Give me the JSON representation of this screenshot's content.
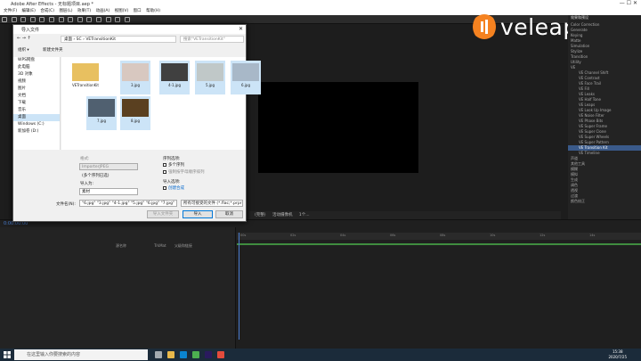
{
  "window": {
    "title": "Adobe After Effects - 无标题项目.aep *"
  },
  "menu": [
    "文件(F)",
    "编辑(E)",
    "合成(C)",
    "图层(L)",
    "效果(T)",
    "动画(A)",
    "视图(V)",
    "窗口",
    "帮助(H)"
  ],
  "brand": {
    "logo_text": "veleap.com",
    "accent": "#f58220"
  },
  "dialog": {
    "title": "导入文件",
    "breadcrumb": [
      "桌面",
      "SC",
      "VETransitionKit"
    ],
    "search_placeholder": "搜索\"VETransitionKit\"",
    "toolbar": {
      "organize": "组织 ▾",
      "new_folder": "新建文件夹"
    },
    "nav": [
      "WPS网盘",
      "此电脑",
      "3D 对象",
      "视频",
      "图片",
      "文档",
      "下载",
      "音乐",
      "桌面",
      "Windows (C:)",
      "新加卷 (D:)"
    ],
    "nav_selected": "桌面",
    "files": [
      {
        "name": "VETransitionKit",
        "type": "folder"
      },
      {
        "name": "3.jpg",
        "type": "image"
      },
      {
        "name": "4-1.jpg",
        "type": "image"
      },
      {
        "name": "5.jpg",
        "type": "image"
      },
      {
        "name": "6.jpg",
        "type": "image"
      },
      {
        "name": "7.jpg",
        "type": "image"
      },
      {
        "name": "8.jpg",
        "type": "image"
      }
    ],
    "format_label": "格式:",
    "format_value": "ImporterJPEG",
    "multi_label": "(多个序列已选)",
    "import_as_label": "导入为:",
    "import_as_value": "素材",
    "sequence_options_label": "序列选项:",
    "sequence_checkbox": "多个序列",
    "force_alpha": "强制按字母顺序排列",
    "import_options_label": "导入选项:",
    "create_comp": "创建合成",
    "filename_label": "文件名(N):",
    "filename_value": "\"6.jpg\" \"3.jpg\" \"4-1.jpg\" \"5.jpg\" \"6.jpg\" \"7.jpg\"",
    "filetype_value": "所有可接受的文件 (*.flac;*.prpr",
    "btn_import_folder": "导入文件夹",
    "btn_import": "导入",
    "btn_cancel": "取消"
  },
  "viewer": {
    "zoom": "(完整)",
    "camera": "活动摄像机",
    "views": "1个..."
  },
  "effects_panel": {
    "search_label": "效果和预设",
    "items": [
      "Color Correction",
      "Generate",
      "Keying",
      "Matte",
      "Simulation",
      "Stylize",
      "Transition",
      "Utility",
      "VE",
      "VE Channel Shift",
      "VE Contrast",
      "VE Face Trail",
      "VE Fill",
      "VE Leaks",
      "VE Half Tone",
      "VE Leaps",
      "VE Look Up Image",
      "VE Noise Filter",
      "VE Phase Bits",
      "VE Super Frame",
      "VE Super Clone",
      "VE Super Wheels",
      "VE Super Pattern",
      "VE Transition Kit",
      "VE Timeline",
      "声道",
      "其他工具",
      "模糊",
      "模拟",
      "生成",
      "调色",
      "透视",
      "过渡",
      "颜色校正"
    ],
    "selected": "VE Transition Kit"
  },
  "timeline": {
    "timecode": "0:00:00:00",
    "col_headers": [
      "源名称",
      "TrkMat",
      "父级和链接"
    ],
    "ticks": [
      "00s",
      "02s",
      "04s",
      "06s",
      "08s",
      "10s",
      "12s",
      "14s"
    ]
  },
  "taskbar": {
    "search_placeholder": "在这里输入你要搜索的内容",
    "time": "15:38",
    "date": "2020/7/25"
  }
}
